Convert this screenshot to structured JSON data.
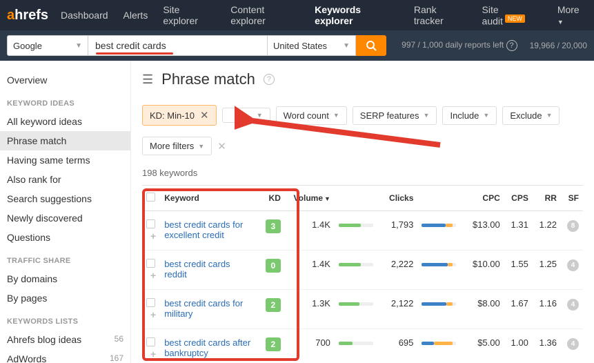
{
  "logo": {
    "a": "a",
    "hrefs": "hrefs"
  },
  "nav": [
    "Dashboard",
    "Alerts",
    "Site explorer",
    "Content explorer",
    "Keywords explorer",
    "Rank tracker",
    "Site audit",
    "More"
  ],
  "nav_active": 4,
  "badge_new": "NEW",
  "engine": "Google",
  "query": "best credit cards",
  "country": "United States",
  "status": {
    "reports": "997 / 1,000 daily reports left",
    "rows": "19,966 / 20,000"
  },
  "sidebar": {
    "overview": "Overview",
    "h1": "KEYWORD IDEAS",
    "ideas": [
      "All keyword ideas",
      "Phrase match",
      "Having same terms",
      "Also rank for",
      "Search suggestions",
      "Newly discovered",
      "Questions"
    ],
    "ideas_active": 1,
    "h2": "TRAFFIC SHARE",
    "traffic": [
      "By domains",
      "By pages"
    ],
    "h3": "KEYWORDS LISTS",
    "lists": [
      {
        "n": "Ahrefs blog ideas",
        "c": "56"
      },
      {
        "n": "AdWords",
        "c": "167"
      }
    ]
  },
  "page_title": "Phrase match",
  "filters": {
    "kd": "KD: Min-10",
    "wordcount": "Word count",
    "serp": "SERP features",
    "include": "Include",
    "exclude": "Exclude",
    "more": "More filters"
  },
  "count": "198 keywords",
  "cols": {
    "kw": "Keyword",
    "kd": "KD",
    "vol": "Volume",
    "clicks": "Clicks",
    "cpc": "CPC",
    "cps": "CPS",
    "rr": "RR",
    "sf": "SF"
  },
  "rows": [
    {
      "kw": "best credit cards for excellent credit",
      "kd": "3",
      "vol": "1.4K",
      "vbar": 65,
      "clicks": "1,793",
      "cbar": 70,
      "cpc": "$13.00",
      "cps": "1.31",
      "rr": "1.22",
      "sf": "8"
    },
    {
      "kw": "best credit cards reddit",
      "kd": "0",
      "vol": "1.4K",
      "vbar": 65,
      "clicks": "2,222",
      "cbar": 75,
      "cpc": "$10.00",
      "cps": "1.55",
      "rr": "1.25",
      "sf": "4"
    },
    {
      "kw": "best credit cards for military",
      "kd": "2",
      "vol": "1.3K",
      "vbar": 60,
      "clicks": "2,122",
      "cbar": 72,
      "cpc": "$8.00",
      "cps": "1.67",
      "rr": "1.16",
      "sf": "4"
    },
    {
      "kw": "best credit cards after bankruptcy",
      "kd": "2",
      "vol": "700",
      "vbar": 40,
      "clicks": "695",
      "cbar": 35,
      "cpc": "$5.00",
      "cps": "1.00",
      "rr": "1.36",
      "sf": "4"
    }
  ]
}
